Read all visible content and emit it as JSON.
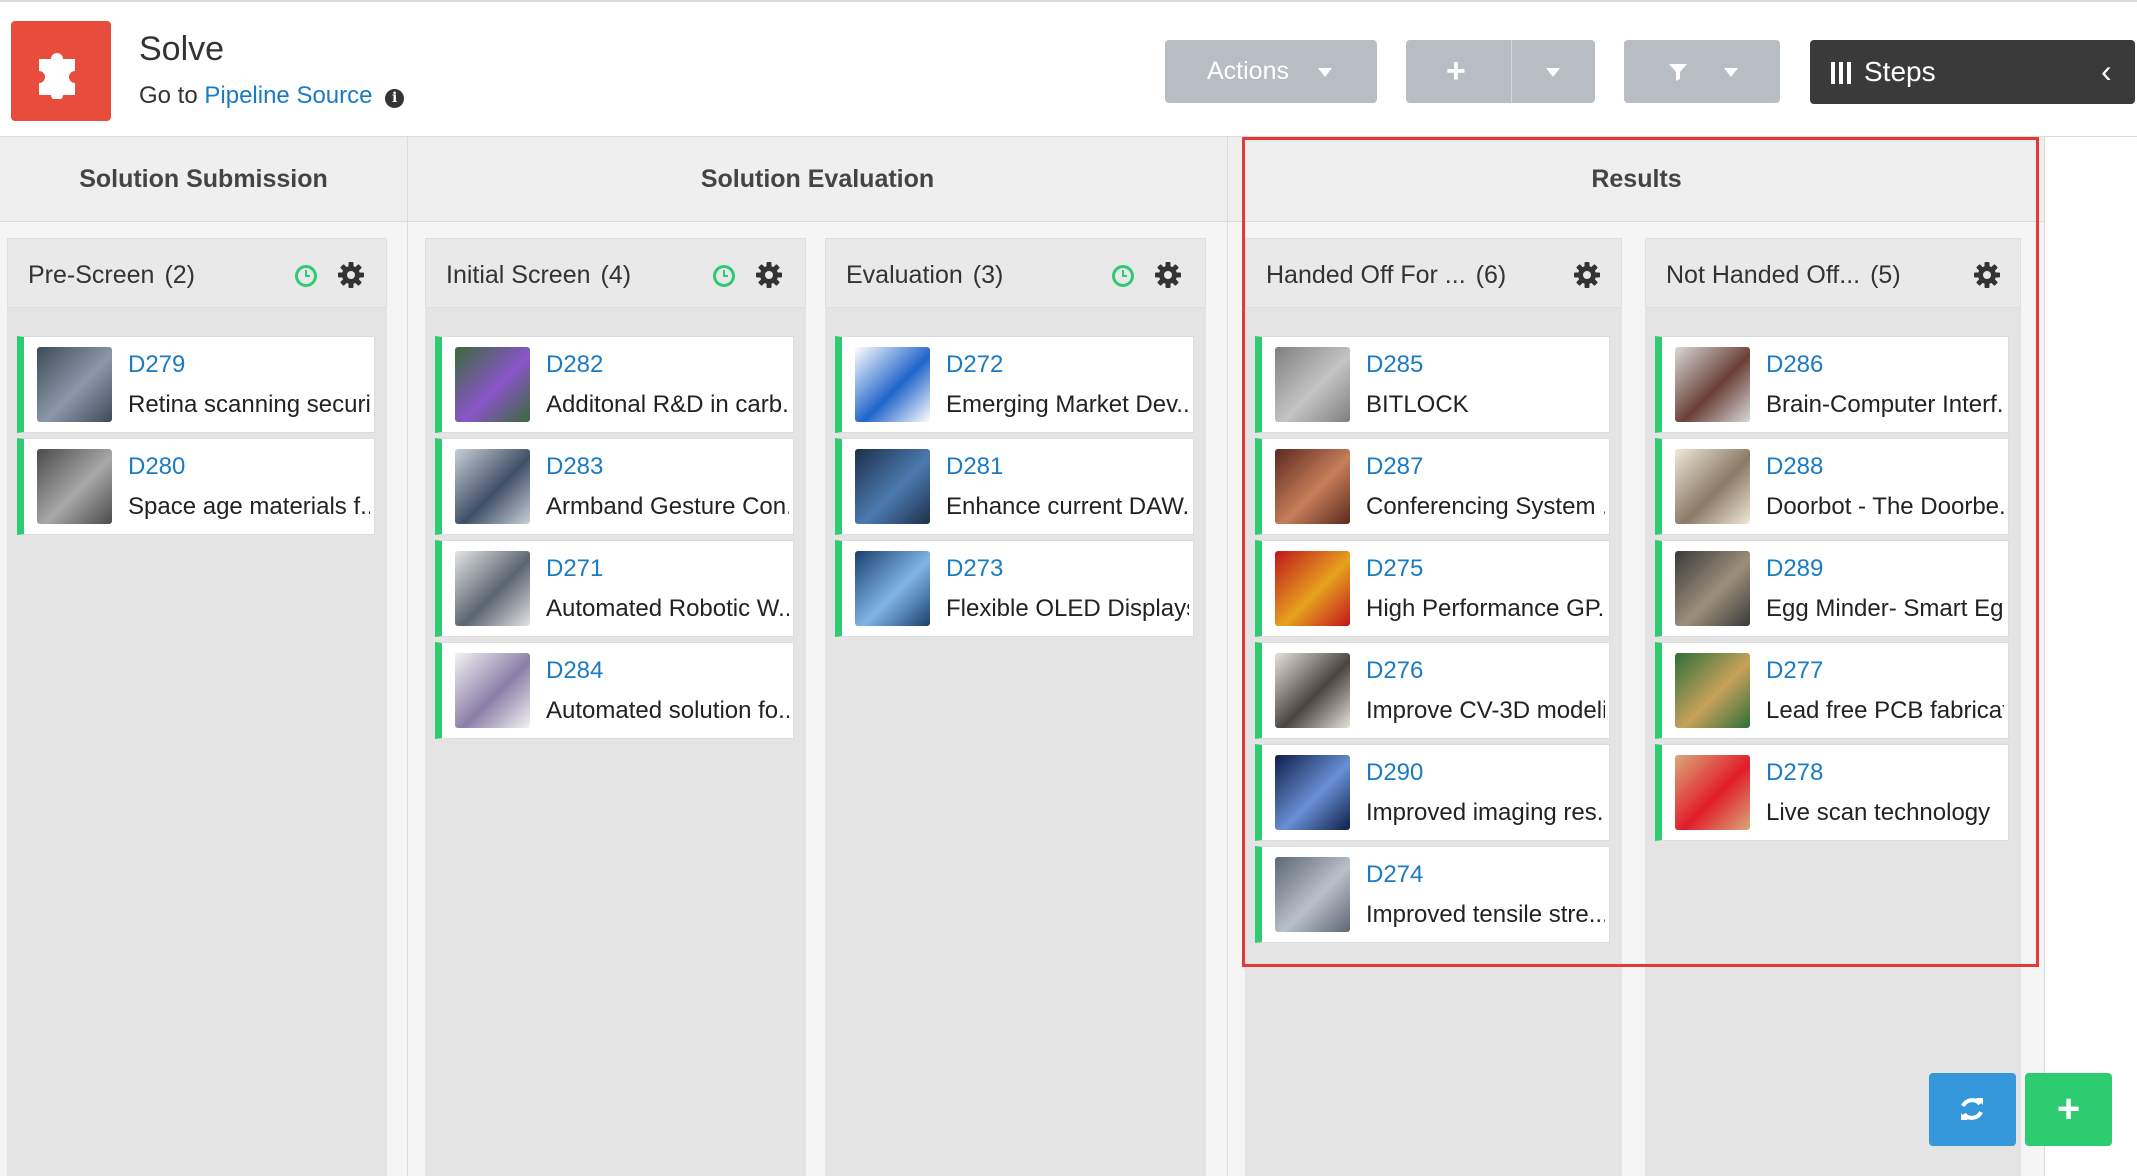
{
  "app": {
    "title": "Solve",
    "goto_prefix": "Go to",
    "goto_link": "Pipeline Source",
    "info_glyph": "i",
    "logo_icon": "puzzle-icon"
  },
  "toolbar": {
    "actions_label": "Actions",
    "add_glyph": "+",
    "steps_label": "Steps",
    "steps_chevron": "‹"
  },
  "groups": [
    {
      "label": "Solution Submission"
    },
    {
      "label": "Solution Evaluation"
    },
    {
      "label": "Results"
    }
  ],
  "columns": [
    {
      "title": "Pre-Screen",
      "count": "(2)",
      "has_clock": true,
      "cards": [
        {
          "id": "D279",
          "title": "Retina scanning security",
          "thumb": [
            "#3d4a57",
            "#8b98a8"
          ]
        },
        {
          "id": "D280",
          "title": "Space age materials f...",
          "thumb": [
            "#4a4a4a",
            "#a8a8a8"
          ]
        }
      ]
    },
    {
      "title": "Initial Screen",
      "count": "(4)",
      "has_clock": true,
      "cards": [
        {
          "id": "D282",
          "title": "Additonal R&D in carb...",
          "thumb": [
            "#3a6a3a",
            "#8a55c9"
          ]
        },
        {
          "id": "D283",
          "title": "Armband Gesture Con...",
          "thumb": [
            "#c9cfd6",
            "#3e4f66"
          ]
        },
        {
          "id": "D271",
          "title": "Automated Robotic W...",
          "thumb": [
            "#e4e4e4",
            "#5a6470"
          ]
        },
        {
          "id": "D284",
          "title": "Automated solution fo...",
          "thumb": [
            "#f2f2f2",
            "#8b7ea8"
          ]
        }
      ]
    },
    {
      "title": "Evaluation",
      "count": "(3)",
      "has_clock": true,
      "cards": [
        {
          "id": "D272",
          "title": "Emerging Market Dev...",
          "thumb": [
            "#ffffff",
            "#1f64c9"
          ]
        },
        {
          "id": "D281",
          "title": "Enhance current DAW...",
          "thumb": [
            "#1c2f4a",
            "#4c7ab0"
          ]
        },
        {
          "id": "D273",
          "title": "Flexible OLED Displays",
          "thumb": [
            "#1b3f6e",
            "#7fb6e6"
          ]
        }
      ]
    },
    {
      "title": "Handed Off For ...",
      "count": "(6)",
      "has_clock": false,
      "cards": [
        {
          "id": "D285",
          "title": "BITLOCK",
          "thumb": [
            "#7f7f7f",
            "#c4c4c4"
          ]
        },
        {
          "id": "D287",
          "title": "Conferencing System ...",
          "thumb": [
            "#5a2a1e",
            "#c77d5a"
          ]
        },
        {
          "id": "D275",
          "title": "High Performance GP...",
          "thumb": [
            "#c0161b",
            "#e6a21f"
          ]
        },
        {
          "id": "D276",
          "title": "Improve CV-3D modeli...",
          "thumb": [
            "#e6e1d9",
            "#4a4440"
          ]
        },
        {
          "id": "D290",
          "title": "Improved imaging res...",
          "thumb": [
            "#0d1f4a",
            "#6a8fd6"
          ]
        },
        {
          "id": "D274",
          "title": "Improved tensile stre...",
          "thumb": [
            "#5d6772",
            "#b8c0c8"
          ]
        }
      ]
    },
    {
      "title": "Not Handed Off...",
      "count": "(5)",
      "has_clock": false,
      "cards": [
        {
          "id": "D286",
          "title": "Brain-Computer Interf...",
          "thumb": [
            "#d8d8d8",
            "#6a4036"
          ]
        },
        {
          "id": "D288",
          "title": "Doorbot - The Doorbe...",
          "thumb": [
            "#efe8d8",
            "#8a7a66"
          ]
        },
        {
          "id": "D289",
          "title": "Egg Minder- Smart Eg...",
          "thumb": [
            "#3a3a3a",
            "#9d8f7a"
          ]
        },
        {
          "id": "D277",
          "title": "Lead free PCB fabricat...",
          "thumb": [
            "#2f6e3a",
            "#c7a25a"
          ]
        },
        {
          "id": "D278",
          "title": "Live scan technology",
          "thumb": [
            "#d9a97a",
            "#e11c2a"
          ]
        }
      ]
    }
  ],
  "fabs": {
    "refresh_icon": "refresh-icon",
    "add_icon": "plus-icon",
    "add_glyph": "+"
  },
  "colors": {
    "brand": "#e74c3c",
    "link": "#1a7bc2",
    "accent_green": "#2ecc71",
    "refresh_blue": "#3498db",
    "highlight_red": "#e53935"
  }
}
